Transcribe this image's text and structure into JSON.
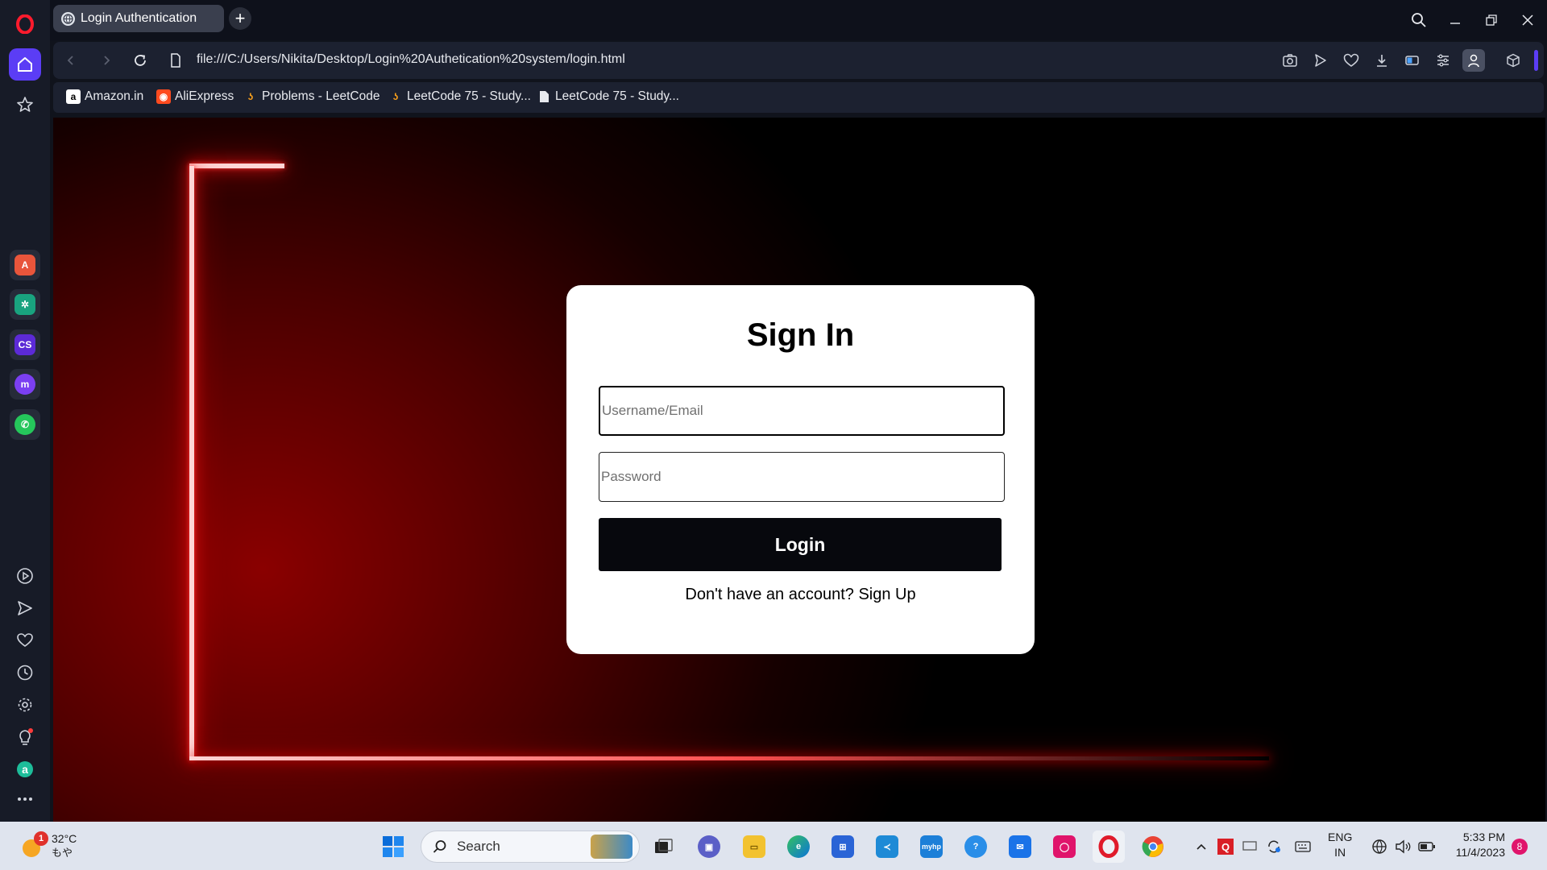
{
  "browser": {
    "tab_title": "Login Authentication",
    "new_tab": "+",
    "url": "file:///C:/Users/Nikita/Desktop/Login%20Authetication%20system/login.html"
  },
  "bookmarks": [
    {
      "label": "Amazon.in",
      "icon": "amazon-icon"
    },
    {
      "label": "AliExpress",
      "icon": "aliexpress-icon"
    },
    {
      "label": "Problems - LeetCode",
      "icon": "leetcode-icon"
    },
    {
      "label": "LeetCode 75 - Study...",
      "icon": "leetcode-icon"
    },
    {
      "label": "LeetCode 75 - Study...",
      "icon": "page-icon"
    }
  ],
  "sidebar_apps": [
    {
      "name": "aria",
      "glyph": "A",
      "color": "#e8553b"
    },
    {
      "name": "chatgpt",
      "glyph": "✲",
      "color": "#19a37f"
    },
    {
      "name": "chatsonic",
      "glyph": "CS",
      "color": "#5c2ad6"
    },
    {
      "name": "messenger",
      "glyph": "m",
      "color": "#7b3ff2"
    },
    {
      "name": "whatsapp",
      "glyph": "✆",
      "color": "#25c65b"
    }
  ],
  "login": {
    "title": "Sign In",
    "username_placeholder": "Username/Email",
    "password_placeholder": "Password",
    "button": "Login",
    "signup_text": "Don't have an account?",
    "signup_link": "Sign Up"
  },
  "taskbar": {
    "weather_temp": "32°C",
    "weather_desc": "もや",
    "weather_badge": "1",
    "search_label": "Search",
    "lang_top": "ENG",
    "lang_bottom": "IN",
    "time": "5:33 PM",
    "date": "11/4/2023",
    "notifications": "8"
  },
  "colors": {
    "accent": "#5b3df5",
    "glow": "#ff1a1a"
  }
}
